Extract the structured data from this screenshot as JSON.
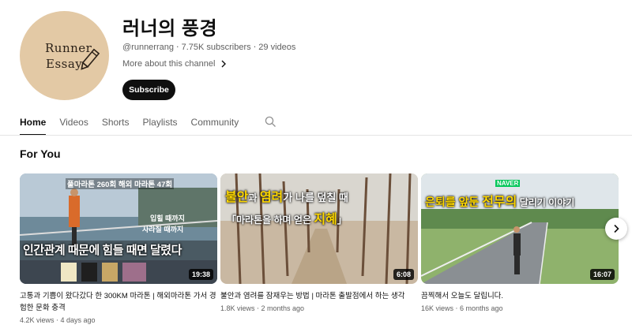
{
  "channel": {
    "avatar_text": [
      "Runner",
      "Essay"
    ],
    "name": "러너의 풍경",
    "handle": "@runnerrang",
    "subscribers": "7.75K subscribers",
    "videos": "29 videos",
    "meta_separator": "‧",
    "more_about": "More about this channel",
    "subscribe_label": "Subscribe"
  },
  "tabs": [
    {
      "label": "Home",
      "active": true
    },
    {
      "label": "Videos",
      "active": false
    },
    {
      "label": "Shorts",
      "active": false
    },
    {
      "label": "Playlists",
      "active": false
    },
    {
      "label": "Community",
      "active": false
    }
  ],
  "section": {
    "title": "For You"
  },
  "videos": [
    {
      "title": "고통과 기쁨이 왔다갔다 한 300KM 마라톤 | 해외마라톤 가서 경험한 문화 충격",
      "views": "4.2K views",
      "age": "4 days ago",
      "duration": "19:38",
      "overlay": {
        "top": "풀마라톤 260회 해외 마라톤 47회",
        "side1": "입힐 때까지",
        "side2": "사라질 때까지",
        "main": "인간관계 때문에 힘들 때면 달렸다"
      }
    },
    {
      "title": "불안과 염려를 잠재우는 방법 | 마라톤 출발점에서 하는 생각",
      "views": "1.8K views",
      "age": "2 months ago",
      "duration": "6:08",
      "overlay": {
        "line1_a": "불안",
        "line1_b": "과 ",
        "line1_c": "염려",
        "line1_d": "가 나를 덮칠 때",
        "line2_a": "「마라톤을 하며 얻은 ",
        "line2_b": "지혜",
        "line2_c": "」"
      }
    },
    {
      "title": "끔찍해서 오늘도 달립니다.",
      "views": "16K views",
      "age": "6 months ago",
      "duration": "16:07",
      "overlay": {
        "badge": "NAVER",
        "main_a": "은퇴를 앞둔 ",
        "main_b": "전무의",
        "main_c": " 달리기 이야기"
      }
    }
  ],
  "colors": {
    "avatar_bg": "#e3c9a5",
    "accent_yellow": "#ffd800",
    "naver_green": "#03c75a"
  }
}
